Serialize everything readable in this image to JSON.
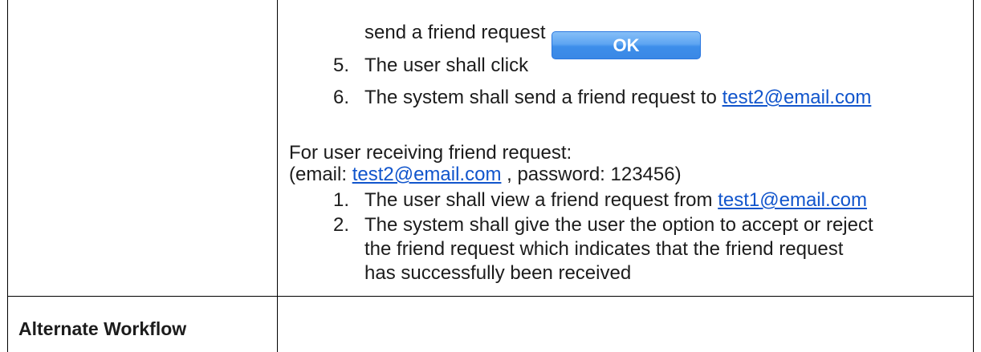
{
  "step_continuation": "send a friend request",
  "steps_a": [
    {
      "num": "5.",
      "text": "The user shall click"
    },
    {
      "num": "6.",
      "text": "The system shall send a friend request to ",
      "link": "test2@email.com"
    }
  ],
  "ok_button_label": "OK",
  "receiver_heading": "For user receiving friend request:",
  "credentials": {
    "prefix": "(email: ",
    "email": "test2@email.com",
    "suffix": " , password: 123456)"
  },
  "steps_b": [
    {
      "num": "1.",
      "text": "The user shall view a friend request from ",
      "link": "test1@email.com"
    },
    {
      "num": "2.",
      "lines": [
        "The system shall give the user the option to accept or reject",
        "the friend request which indicates that the friend request",
        "has successfully been received"
      ]
    }
  ],
  "alternate_workflow_label": "Alternate Workflow"
}
